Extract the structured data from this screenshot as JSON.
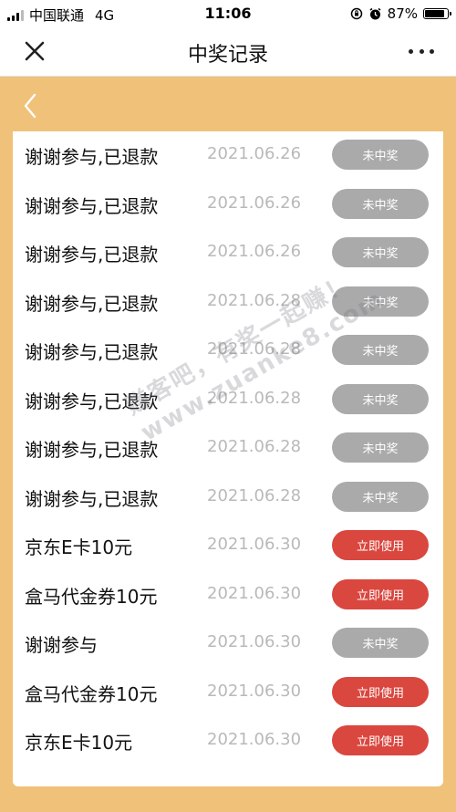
{
  "status_bar": {
    "carrier": "中国联通",
    "network": "4G",
    "time": "11:06",
    "battery_text": "87%",
    "battery_level": 0.87
  },
  "navbar": {
    "title": "中奖记录",
    "close_icon": "close-icon",
    "more_icon": "more-icon"
  },
  "back_icon": "chevron-left-icon",
  "records": [
    {
      "name": "谢谢参与,已退款",
      "date": "2021.06.26",
      "action": "未中奖",
      "style": "gray"
    },
    {
      "name": "谢谢参与,已退款",
      "date": "2021.06.26",
      "action": "未中奖",
      "style": "gray"
    },
    {
      "name": "谢谢参与,已退款",
      "date": "2021.06.26",
      "action": "未中奖",
      "style": "gray"
    },
    {
      "name": "谢谢参与,已退款",
      "date": "2021.06.28",
      "action": "未中奖",
      "style": "gray"
    },
    {
      "name": "谢谢参与,已退款",
      "date": "2021.06.28",
      "action": "未中奖",
      "style": "gray"
    },
    {
      "name": "谢谢参与,已退款",
      "date": "2021.06.28",
      "action": "未中奖",
      "style": "gray"
    },
    {
      "name": "谢谢参与,已退款",
      "date": "2021.06.28",
      "action": "未中奖",
      "style": "gray"
    },
    {
      "name": "谢谢参与,已退款",
      "date": "2021.06.28",
      "action": "未中奖",
      "style": "gray"
    },
    {
      "name": "京东E卡10元",
      "date": "2021.06.30",
      "action": "立即使用",
      "style": "red"
    },
    {
      "name": "盒马代金券10元",
      "date": "2021.06.30",
      "action": "立即使用",
      "style": "red"
    },
    {
      "name": "谢谢参与",
      "date": "2021.06.30",
      "action": "未中奖",
      "style": "gray"
    },
    {
      "name": "盒马代金券10元",
      "date": "2021.06.30",
      "action": "立即使用",
      "style": "red"
    },
    {
      "name": "京东E卡10元",
      "date": "2021.06.30",
      "action": "立即使用",
      "style": "red"
    }
  ],
  "watermark": {
    "line1": "赚客吧，有奖一起赚！",
    "line2": "www.zuanke8.com"
  },
  "colors": {
    "background": "#f0c178",
    "button_gray": "#aaaaaa",
    "button_red": "#d9473f",
    "date_text": "#b9b9b9"
  }
}
